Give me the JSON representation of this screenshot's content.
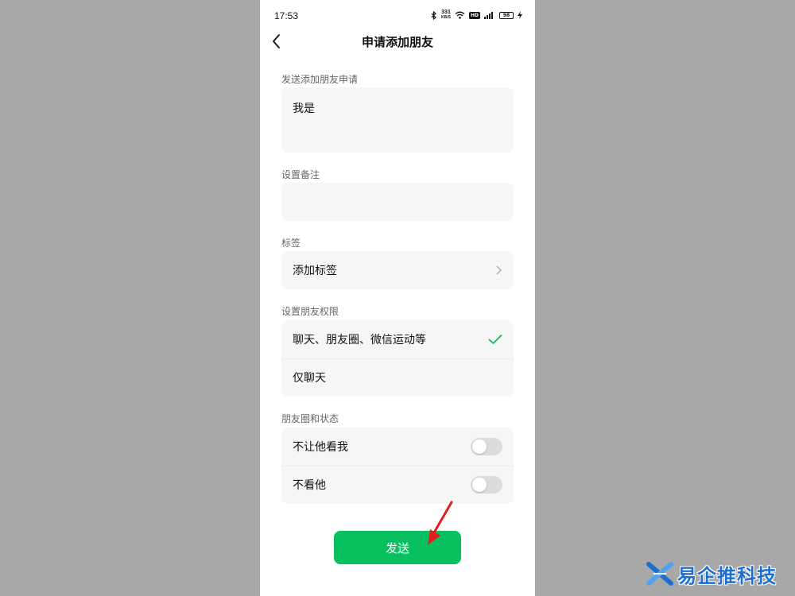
{
  "status_bar": {
    "time": "17:53",
    "net_speed_value": "331",
    "net_speed_unit": "KB/S",
    "hd_label": "HD",
    "signal_label": "4G",
    "battery": "98"
  },
  "nav": {
    "title": "申请添加朋友"
  },
  "request": {
    "label": "发送添加朋友申请",
    "value": "我是"
  },
  "remark": {
    "label": "设置备注",
    "value": ""
  },
  "tags": {
    "label": "标签",
    "add_label": "添加标签"
  },
  "permissions": {
    "label": "设置朋友权限",
    "options": [
      {
        "label": "聊天、朋友圈、微信运动等",
        "selected": true
      },
      {
        "label": "仅聊天",
        "selected": false
      }
    ]
  },
  "moments": {
    "label": "朋友圈和状态",
    "toggles": [
      {
        "label": "不让他看我",
        "on": false
      },
      {
        "label": "不看他",
        "on": false
      }
    ]
  },
  "send_button": {
    "label": "发送"
  },
  "watermark": {
    "text": "易企推科技"
  },
  "colors": {
    "accent_green": "#07c160",
    "check_green": "#07c160",
    "annotation_red": "#e0201c",
    "watermark_blue": "#1c6fd1"
  }
}
